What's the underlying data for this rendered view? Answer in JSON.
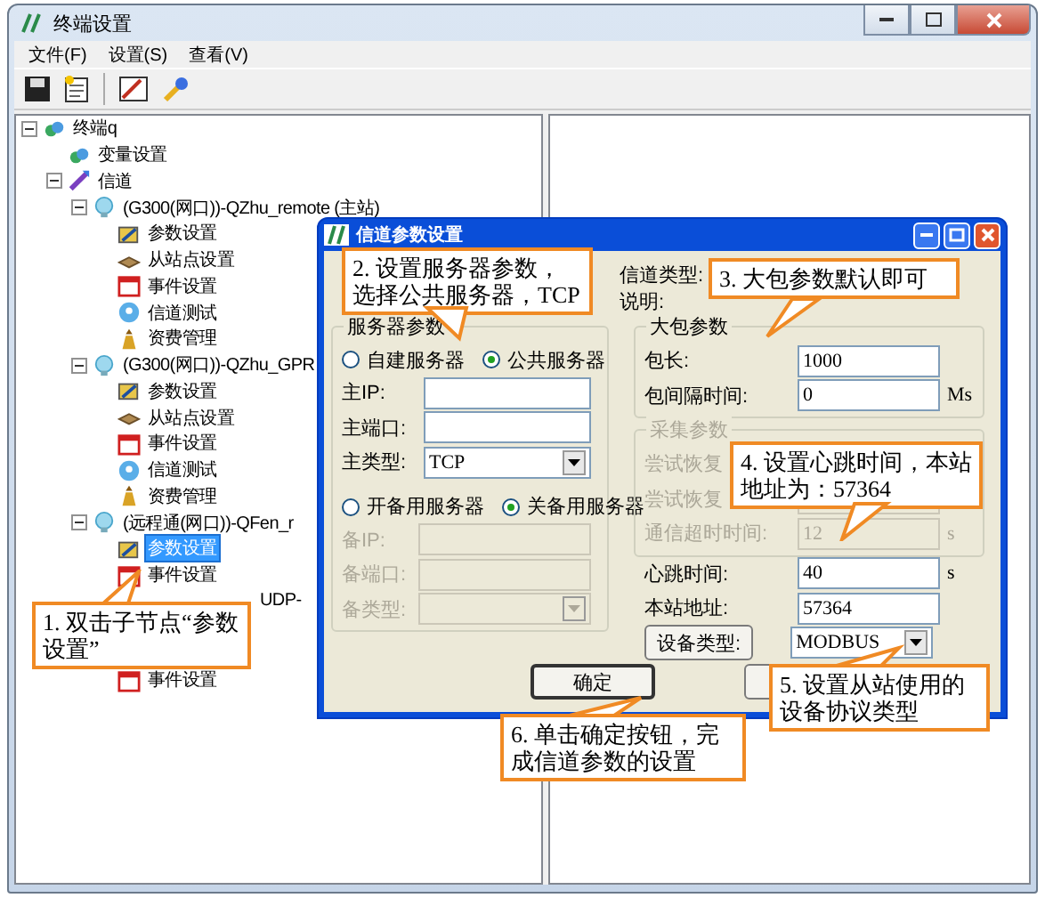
{
  "window": {
    "title": "终端设置"
  },
  "menu": [
    "文件(F)",
    "设置(S)",
    "查看(V)"
  ],
  "tree": {
    "label": "终端q",
    "kind": "terminal",
    "expanded": true,
    "selected": false,
    "children": [
      {
        "label": "变量设置",
        "kind": "variable",
        "selected": false
      },
      {
        "label": "信道",
        "kind": "channels",
        "expanded": true,
        "selected": false,
        "children": [
          {
            "label": "(G300(网口))-QZhu_remote (主站)",
            "kind": "channel",
            "expanded": true,
            "selected": false,
            "children": [
              {
                "label": "参数设置",
                "kind": "params",
                "selected": false
              },
              {
                "label": "从站点设置",
                "kind": "slave",
                "selected": false
              },
              {
                "label": "事件设置",
                "kind": "event",
                "selected": false
              },
              {
                "label": "信道测试",
                "kind": "test",
                "selected": false
              },
              {
                "label": "资费管理",
                "kind": "billing",
                "selected": false
              }
            ]
          },
          {
            "label": "(G300(网口))-QZhu_GPR",
            "kind": "channel",
            "expanded": true,
            "selected": false,
            "children": [
              {
                "label": "参数设置",
                "kind": "params",
                "selected": false
              },
              {
                "label": "从站点设置",
                "kind": "slave",
                "selected": false
              },
              {
                "label": "事件设置",
                "kind": "event",
                "selected": false
              },
              {
                "label": "信道测试",
                "kind": "test",
                "selected": false
              },
              {
                "label": "资费管理",
                "kind": "billing",
                "selected": false
              }
            ]
          },
          {
            "label": "(远程通(网口))-QFen_r",
            "kind": "channel",
            "expanded": true,
            "selected": false,
            "children": [
              {
                "label": "参数设置",
                "kind": "params",
                "selected": true
              },
              {
                "label": "事件设置",
                "kind": "event",
                "selected": false
              }
            ]
          },
          {
            "label": "UDP-",
            "selected": false,
            "children": [
              {
                "label": "事件设置",
                "kind": "event",
                "selected": false
              }
            ]
          }
        ]
      }
    ]
  },
  "dialog": {
    "title": "信道参数设置",
    "server": {
      "title": "服务器参数",
      "modes": [
        {
          "label": "自建服务器",
          "selected": false
        },
        {
          "label": "公共服务器",
          "selected": true
        }
      ],
      "primary": [
        {
          "label": "主IP:",
          "kind": "text",
          "disabled": false
        },
        {
          "label": "主端口:",
          "kind": "text",
          "disabled": false
        },
        {
          "label": "主类型:",
          "kind": "select",
          "value": "TCP",
          "disabled": false
        }
      ],
      "backup_modes": [
        {
          "label": "开备用服务器",
          "selected": false
        },
        {
          "label": "关备用服务器",
          "selected": true
        }
      ],
      "backup": [
        {
          "label": "备IP:",
          "kind": "text",
          "disabled": true
        },
        {
          "label": "备端口:",
          "kind": "text",
          "disabled": true
        },
        {
          "label": "备类型:",
          "kind": "select",
          "disabled": true
        }
      ]
    },
    "right_labels": [
      "信道类型:",
      "说明:"
    ],
    "packet": {
      "title": "大包参数",
      "disabled": false,
      "fields": [
        {
          "label": "包长:",
          "value": "1000"
        },
        {
          "label": "包间隔时间:",
          "value": "0",
          "unit": "Ms"
        }
      ]
    },
    "collect": {
      "title": "采集参数",
      "disabled": true,
      "fields": [
        {
          "label": "尝试恢复"
        },
        {
          "label": "尝试恢复"
        },
        {
          "label": "通信超时时间:",
          "value": "12",
          "unit": "s"
        }
      ]
    },
    "heartbeat": {
      "label": "心跳时间:",
      "value": "40",
      "unit": "s"
    },
    "station": {
      "label": "本站地址:",
      "value": "57364"
    },
    "device": {
      "button": "设备类型:",
      "value": "MODBUS"
    },
    "ok": "确定"
  },
  "callouts": [
    {
      "text": "1. 双击子节点“参数设置”"
    },
    {
      "text": "2. 设置服务器参数，选择公共服务器，TCP"
    },
    {
      "text": "3. 大包参数默认即可"
    },
    {
      "text": "4. 设置心跳时间，本站地址为：57364"
    },
    {
      "text": "5. 设置从站使用的设备协议类型"
    },
    {
      "text": "6. 单击确定按钮，完成信道参数的设置"
    }
  ]
}
